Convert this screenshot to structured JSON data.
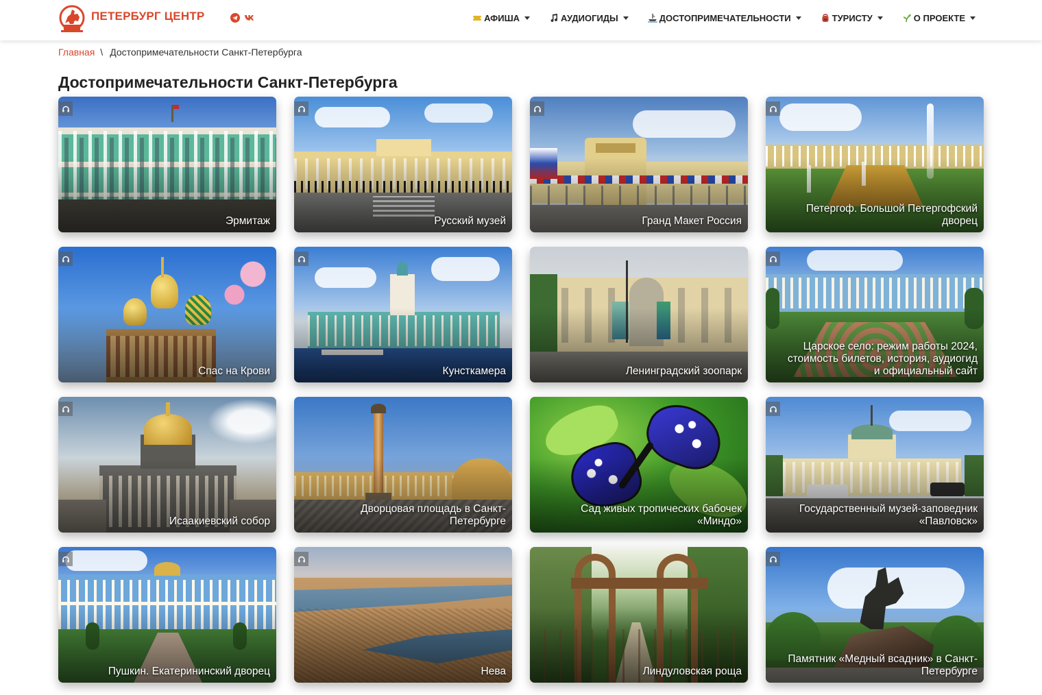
{
  "header": {
    "logo_text": "ПЕТЕРБУРГ ЦЕНТР",
    "nav": [
      {
        "label": "Афиша",
        "icon": "ticket-icon"
      },
      {
        "label": "Аудиогиды",
        "icon": "music-note-icon"
      },
      {
        "label": "Достопримечательности",
        "icon": "ship-icon"
      },
      {
        "label": "Туристу",
        "icon": "backpack-icon"
      },
      {
        "label": "О проекте",
        "icon": "sprout-icon"
      }
    ],
    "social": [
      "telegram-icon",
      "vk-icon"
    ]
  },
  "breadcrumb": {
    "home": "Главная",
    "separator": "\\",
    "current": "Достопримечательности Санкт-Петербурга"
  },
  "page_title": "Достопримечательности Санкт-Петербурга",
  "cards": [
    {
      "title": "Эрмитаж",
      "audio": true
    },
    {
      "title": "Русский музей",
      "audio": true
    },
    {
      "title": "Гранд Макет Россия",
      "audio": true
    },
    {
      "title": "Петергоф. Большой Петергофский дворец",
      "audio": true
    },
    {
      "title": "Спас на Крови",
      "audio": true
    },
    {
      "title": "Кунсткамера",
      "audio": true
    },
    {
      "title": "Ленинградский зоопарк",
      "audio": false
    },
    {
      "title": "Царское село: режим работы 2024, стоимость билетов, история, аудиогид и официальный сайт",
      "audio": true
    },
    {
      "title": "Исаакиевский собор",
      "audio": true
    },
    {
      "title": "Дворцовая площадь в Санкт-Петербурге",
      "audio": false
    },
    {
      "title": "Сад живых тропических бабочек «Миндо»",
      "audio": false
    },
    {
      "title": "Государственный музей-заповедник «Павловск»",
      "audio": true
    },
    {
      "title": "Пушкин. Екатерининский дворец",
      "audio": true
    },
    {
      "title": "Нева",
      "audio": true
    },
    {
      "title": "Линдуловская роща",
      "audio": false
    },
    {
      "title": "Памятник «Медный всадник» в Санкт-Петербурге",
      "audio": true
    }
  ],
  "colors": {
    "brand": "#d9472b",
    "text": "#222222"
  }
}
